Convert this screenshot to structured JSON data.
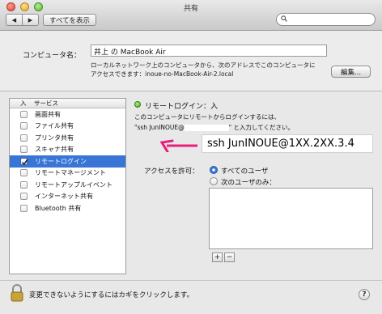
{
  "window": {
    "title": "共有"
  },
  "toolbar": {
    "back_icon": "◀",
    "forward_icon": "▶",
    "show_all_label": "すべてを表示",
    "search_placeholder": ""
  },
  "computer_name": {
    "label": "コンピュータ名：",
    "value": "井上 の MacBook Air",
    "description_line1": "ローカルネットワーク上のコンピュータから、次のアドレスでこのコンピュータに",
    "description_line2": "アクセスできます：inoue-no-MacBook-Air-2.local",
    "edit_label": "編集..."
  },
  "services": {
    "header_on": "入",
    "header_service": "サービス",
    "items": [
      {
        "label": "画面共有",
        "checked": false,
        "selected": false
      },
      {
        "label": "ファイル共有",
        "checked": false,
        "selected": false
      },
      {
        "label": "プリンタ共有",
        "checked": false,
        "selected": false
      },
      {
        "label": "スキャナ共有",
        "checked": false,
        "selected": false
      },
      {
        "label": "リモートログイン",
        "checked": true,
        "selected": true
      },
      {
        "label": "リモートマネージメント",
        "checked": false,
        "selected": false
      },
      {
        "label": "リモートアップルイベント",
        "checked": false,
        "selected": false
      },
      {
        "label": "インターネット共有",
        "checked": false,
        "selected": false
      },
      {
        "label": "Bluetooth 共有",
        "checked": false,
        "selected": false
      }
    ]
  },
  "status": {
    "text": "リモートログイン：入",
    "color": "#3fa51c",
    "info_line1": "このコンピュータにリモートからログインするには、",
    "ssh_prefix": "\"ssh JunINOUE@",
    "ssh_suffix": "\" と入力してください。"
  },
  "callout": {
    "text": "ssh JunINOUE@1XX.2XX.3.4",
    "arrow_color": "#e8207c"
  },
  "access": {
    "label": "アクセスを許可：",
    "option_all": "すべてのユーザ",
    "option_only": "次のユーザのみ：",
    "add_label": "+",
    "remove_label": "−"
  },
  "footer": {
    "lock_text": "変更できないようにするにはカギをクリックします。",
    "help_label": "?"
  }
}
